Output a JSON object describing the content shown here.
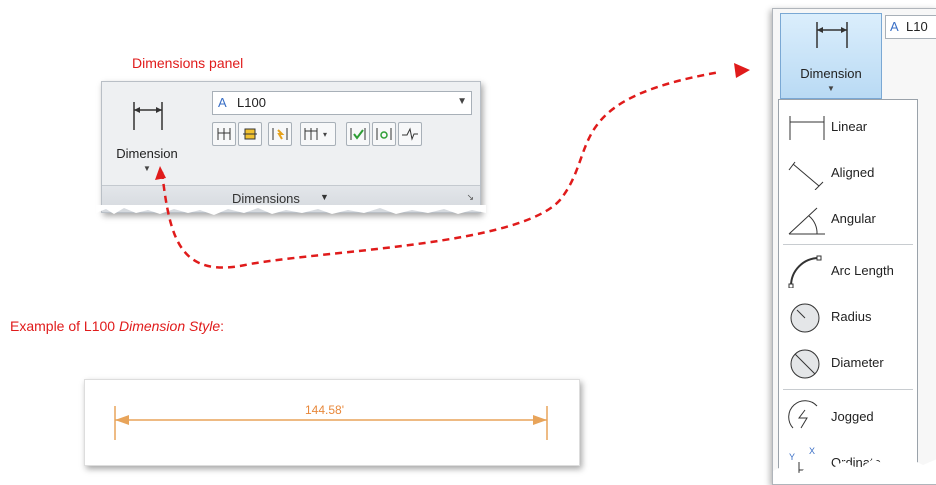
{
  "labels": {
    "panel_caption": "Dimensions panel",
    "example_caption_prefix": "Example of L100 ",
    "example_caption_italic": "Dimension Style",
    "example_caption_suffix": ":"
  },
  "panel": {
    "big_button_label": "Dimension",
    "style_combo_value": "L100",
    "footer_label": "Dimensions",
    "tools": [
      "Continue",
      "Inspect",
      "Update",
      "Adjust space",
      "Reassociate",
      "Restore",
      "Jog line"
    ]
  },
  "sample": {
    "dimension_text": "144.58'"
  },
  "menu": {
    "button_label": "Dimension",
    "combo_partial": "L10",
    "items": [
      {
        "label": "Linear",
        "icon": "linear-dimension-icon"
      },
      {
        "label": "Aligned",
        "icon": "aligned-dimension-icon"
      },
      {
        "label": "Angular",
        "icon": "angular-dimension-icon"
      },
      {
        "label": "Arc Length",
        "icon": "arc-length-icon"
      },
      {
        "label": "Radius",
        "icon": "radius-icon"
      },
      {
        "label": "Diameter",
        "icon": "diameter-icon"
      },
      {
        "label": "Jogged",
        "icon": "jogged-icon"
      },
      {
        "label": "Ordinate",
        "icon": "ordinate-icon"
      }
    ]
  },
  "colors": {
    "annotation_red": "#e01b1b",
    "dimension_orange": "#e8883a",
    "hover_blue": "#b9daf4"
  }
}
